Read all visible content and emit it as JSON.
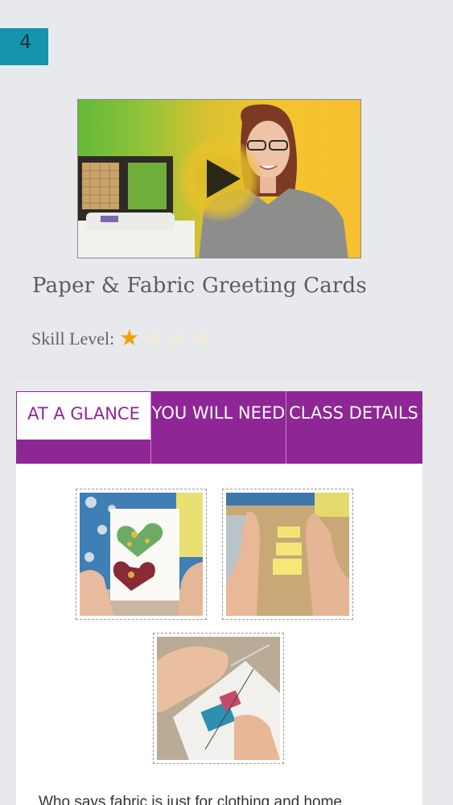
{
  "lesson": {
    "number": "4"
  },
  "video": {
    "play_icon": "play-icon"
  },
  "class": {
    "title": "Paper & Fabric Greeting Cards",
    "skill_label": "Skill Level:",
    "skill_rating": 1,
    "skill_max": 4
  },
  "tabs": [
    {
      "label": "AT A GLANCE",
      "active": true
    },
    {
      "label": "YOU WILL NEED",
      "active": false
    },
    {
      "label": "CLASS DETAILS",
      "active": false
    }
  ],
  "colors": {
    "badge": "#1495ad",
    "tab_bar": "#8f2696",
    "star_on": "#f2a200",
    "star_off": "#f1ebd8"
  },
  "content": {
    "intro_text": "Who says fabric is just for clothing and home"
  }
}
